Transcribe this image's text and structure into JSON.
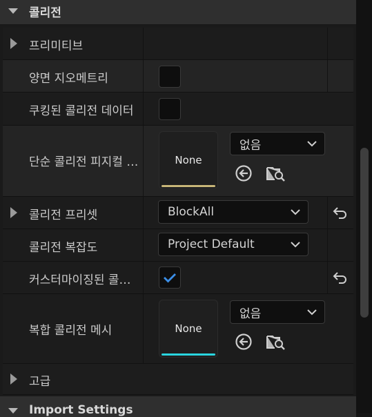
{
  "collision_section": {
    "title": "콜리전"
  },
  "rows": {
    "primitives": {
      "label": "프리미티브"
    },
    "double_sided": {
      "label": "양면 지오메트리",
      "checked": false
    },
    "cooked_data": {
      "label": "쿠킹된 콜리전 데이터",
      "checked": false
    },
    "simple_collision": {
      "label": "단순 콜리전 피지컬 머티리얼",
      "thumbnail": "None",
      "dropdown": "없음"
    },
    "presets": {
      "label": "콜리전 프리셋",
      "dropdown": "BlockAll"
    },
    "complexity": {
      "label": "콜리전 복잡도",
      "dropdown": "Project Default"
    },
    "customized": {
      "label": "커스터마이징된 콜리전",
      "checked": true
    },
    "complex_mesh": {
      "label": "복합 콜리전 메시",
      "thumbnail": "None",
      "dropdown": "없음"
    },
    "advanced": {
      "label": "고급"
    }
  },
  "import_section": {
    "title": "Import Settings"
  },
  "icons": {
    "back_arrow": "arrow-left-circle-icon",
    "browse": "folder-search-icon",
    "reset": "reset-arrow-icon",
    "chevron": "chevron-down-icon",
    "check": "checkmark-icon"
  },
  "colors": {
    "check": "#3b8fe8",
    "thumb_bar_material": "#c8b678",
    "thumb_bar_mesh": "#2ad6e0"
  }
}
